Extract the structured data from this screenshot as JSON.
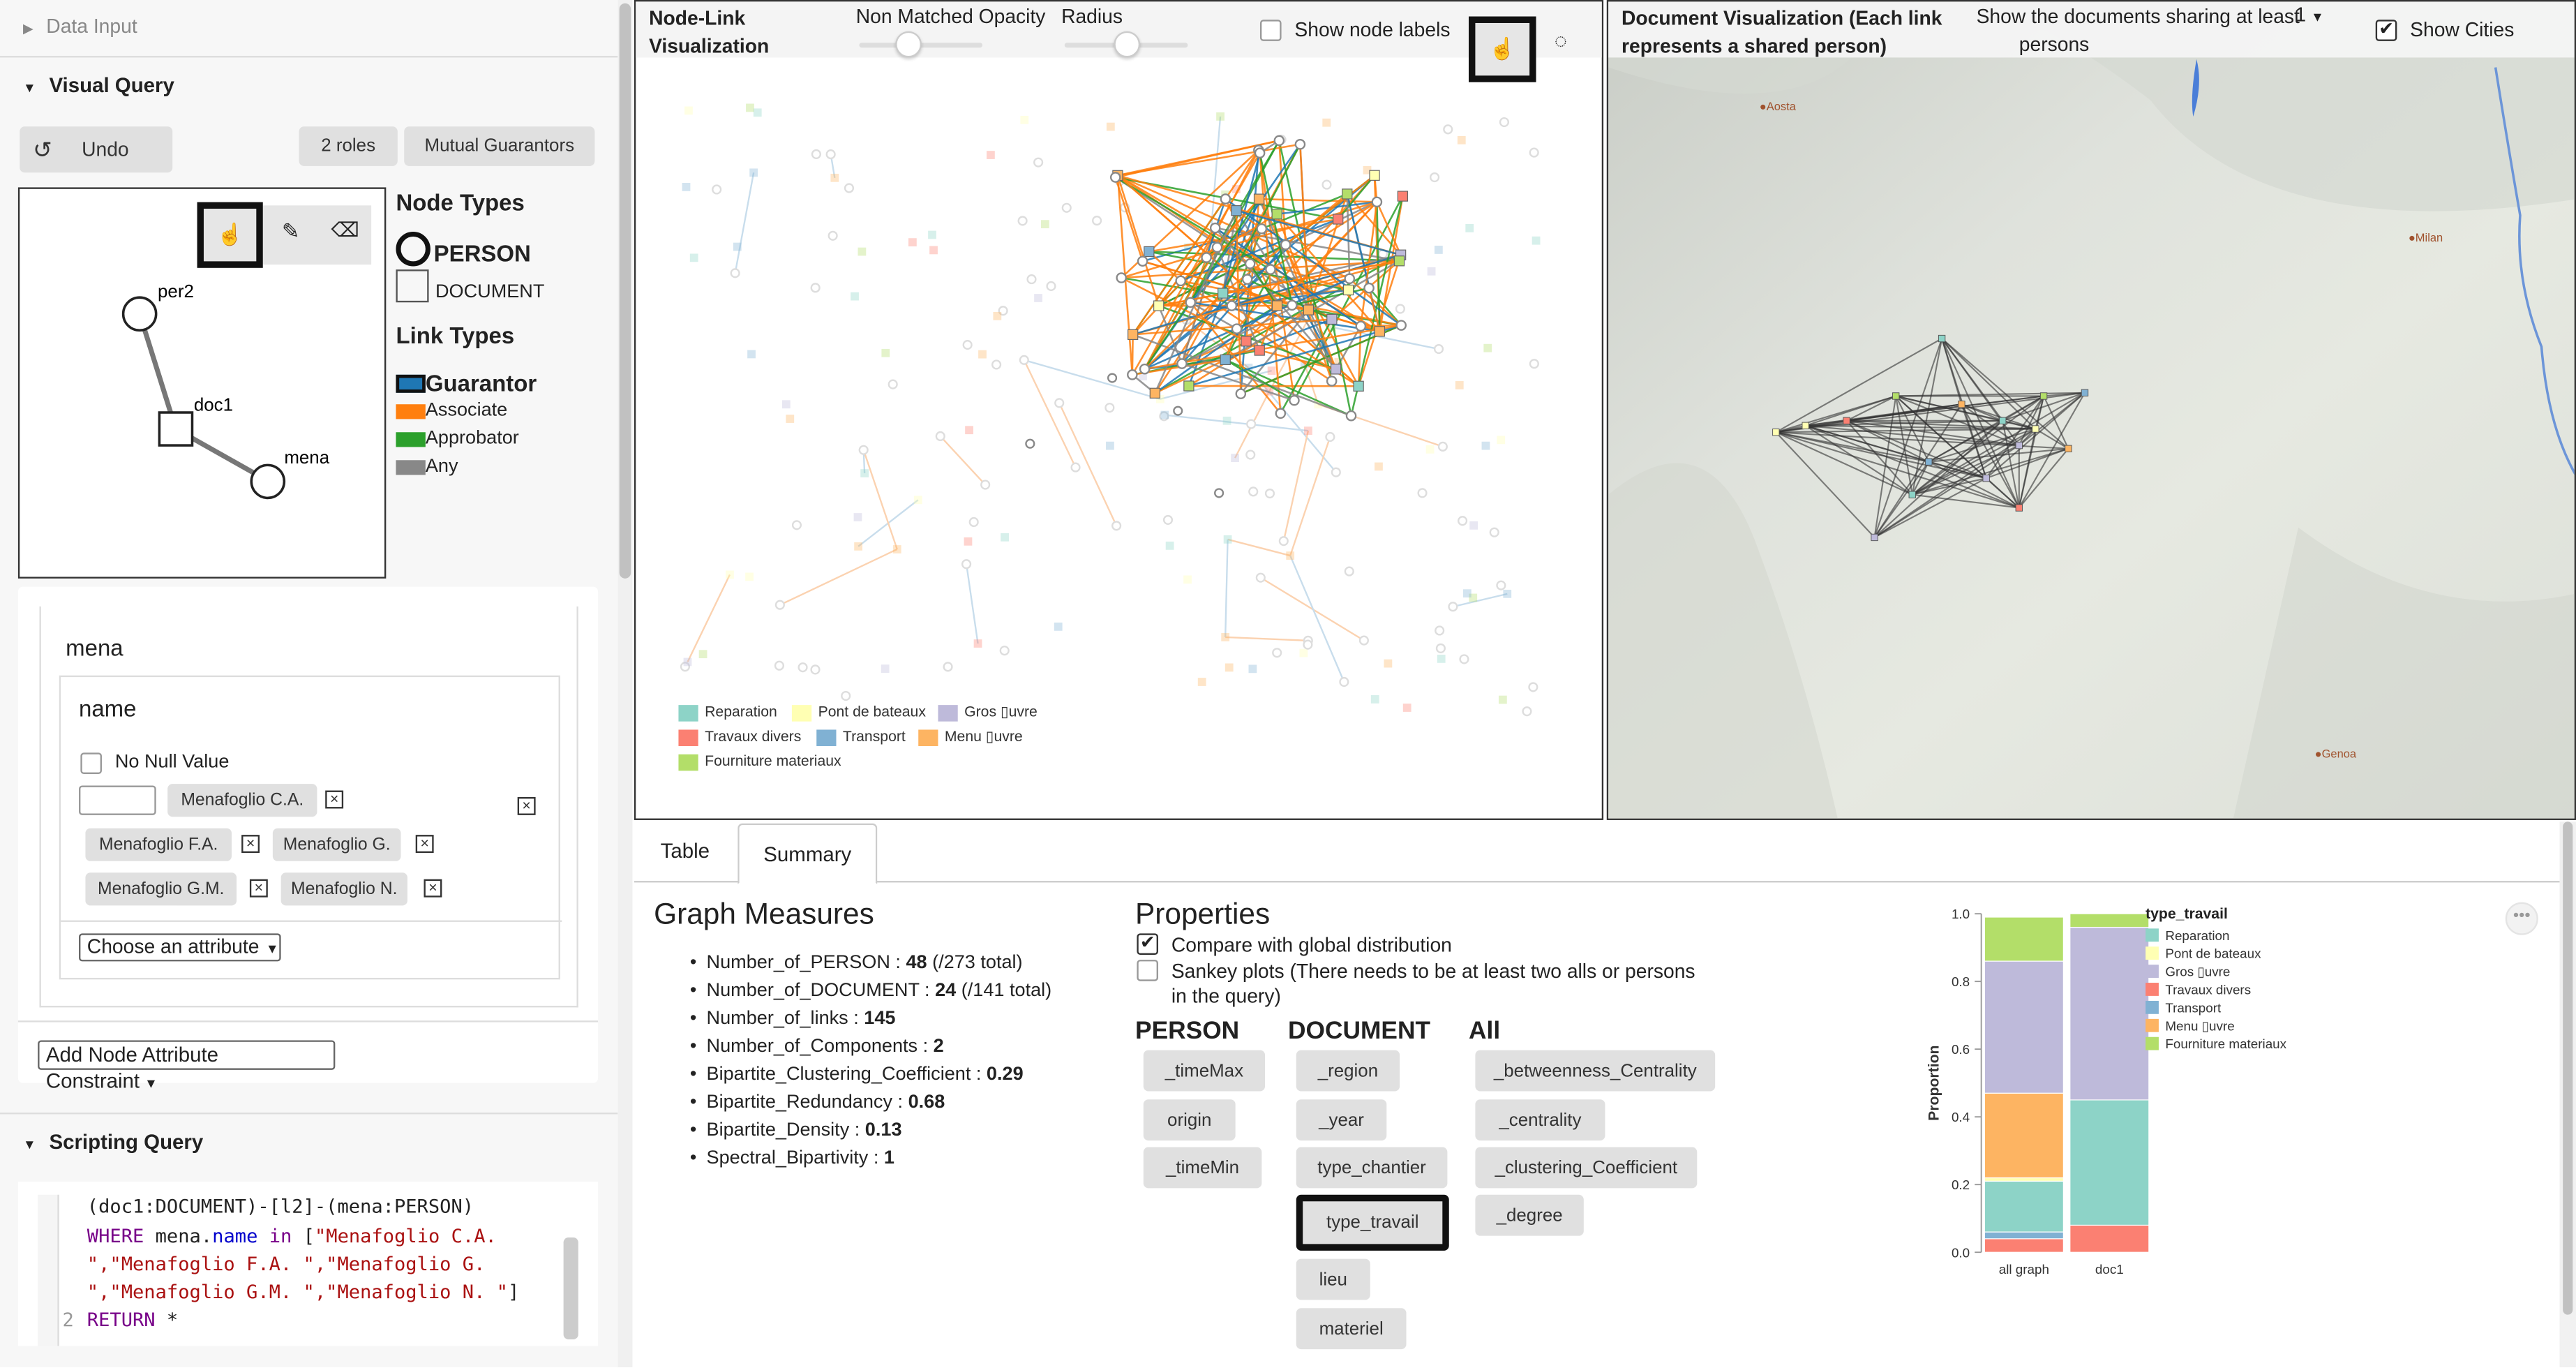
{
  "left": {
    "data_input": "Data Input",
    "visual_query": "Visual Query",
    "undo": "Undo",
    "two_roles": "2 roles",
    "mutual_guarantors": "Mutual Guarantors",
    "node_types_title": "Node Types",
    "node_person": "PERSON",
    "node_document": "DOCUMENT",
    "link_types_title": "Link Types",
    "links": [
      {
        "label": "Guarantor",
        "color": "#1f77b4"
      },
      {
        "label": "Associate",
        "color": "#ff7f0e"
      },
      {
        "label": "Approbator",
        "color": "#2ca02c"
      },
      {
        "label": "Any",
        "color": "#888888"
      }
    ],
    "graph_nodes": {
      "per2": "per2",
      "doc1": "doc1",
      "mena": "mena"
    },
    "constraint": {
      "node": "mena",
      "attribute": "name",
      "no_null": "No Null Value",
      "values": [
        "Menafoglio C.A.",
        "Menafoglio F.A.",
        "Menafoglio G.",
        "Menafoglio G.M.",
        "Menafoglio N."
      ],
      "choose_attr": "Choose an attribute"
    },
    "add_constraint": "Add Node Attribute Constraint",
    "scripting_query": "Scripting Query",
    "code": {
      "l1": "(doc1:DOCUMENT)-[l2]-(mena:PERSON)",
      "l2a": "WHERE ",
      "l2b": "mena",
      "l2c": ".",
      "l2d": "name",
      "l2e": " in ",
      "l2f": "[",
      "l2g": "\"Menafoglio C.A.",
      "l3": "\",\"Menafoglio F.A. \",\"Menafoglio G.",
      "l4": "\",\"Menafoglio G.M. \",\"Menafoglio N. \"",
      "l4b": "]",
      "ln": "2",
      "l5": "RETURN",
      "l5b": " *"
    }
  },
  "nodelink": {
    "title": "Node-Link Visualization",
    "opacity_label": "Non Matched Opacity",
    "opacity_value": 0.4,
    "radius_label": "Radius",
    "radius_value": 0.5,
    "show_labels": "Show node labels",
    "legend": [
      {
        "label": "Reparation",
        "color": "#8dd3c7"
      },
      {
        "label": "Pont de bateaux",
        "color": "#ffffb3"
      },
      {
        "label": "Gros ▯uvre",
        "color": "#bebada"
      },
      {
        "label": "Travaux divers",
        "color": "#fb8072"
      },
      {
        "label": "Transport",
        "color": "#80b1d3"
      },
      {
        "label": "Menu ▯uvre",
        "color": "#fdb462"
      },
      {
        "label": "Fourniture materiaux",
        "color": "#b3de69"
      }
    ]
  },
  "docvis": {
    "title": "Document Visualization (Each link represents a shared person)",
    "sharing_label": "Show the documents sharing at least",
    "sharing_value": "1",
    "sharing_suffix": "persons",
    "show_cities": "Show Cities",
    "cities": [
      "Aosta",
      "Milan",
      "Genoa"
    ]
  },
  "tabs": {
    "table": "Table",
    "summary": "Summary"
  },
  "measures": {
    "title": "Graph Measures",
    "items": [
      {
        "k": "Number_of_PERSON : ",
        "v": "48",
        "s": " (/273 total)"
      },
      {
        "k": "Number_of_DOCUMENT : ",
        "v": "24",
        "s": " (/141 total)"
      },
      {
        "k": "Number_of_links : ",
        "v": "145",
        "s": ""
      },
      {
        "k": "Number_of_Components : ",
        "v": "2",
        "s": ""
      },
      {
        "k": "Bipartite_Clustering_Coefficient : ",
        "v": "0.29",
        "s": ""
      },
      {
        "k": "Bipartite_Redundancy : ",
        "v": "0.68",
        "s": ""
      },
      {
        "k": "Bipartite_Density : ",
        "v": "0.13",
        "s": ""
      },
      {
        "k": "Spectral_Bipartivity : ",
        "v": "1",
        "s": ""
      }
    ]
  },
  "properties": {
    "title": "Properties",
    "compare": "Compare with global distribution",
    "sankey": "Sankey plots (There needs to be at least two alls or persons in the query)",
    "person_title": "PERSON",
    "document_title": "DOCUMENT",
    "all_title": "All",
    "person": [
      "_timeMax",
      "origin",
      "_timeMin"
    ],
    "document": [
      "_region",
      "_year",
      "type_chantier",
      "type_travail",
      "lieu",
      "materiel"
    ],
    "all": [
      "_betweenness_Centrality",
      "_centrality",
      "_clustering_Coefficient",
      "_degree"
    ]
  },
  "chart_data": {
    "type": "bar",
    "stacked": true,
    "title": "type_travail",
    "xlabel": "",
    "ylabel": "Proportion",
    "ylim": [
      0,
      1
    ],
    "yticks": [
      "0.0",
      "0.2",
      "0.4",
      "0.6",
      "0.8",
      "1.0"
    ],
    "categories": [
      "all graph",
      "doc1"
    ],
    "legend_position": "right",
    "series": [
      {
        "name": "Travaux divers",
        "color": "#fb8072",
        "values": [
          0.04,
          0.08
        ]
      },
      {
        "name": "Transport",
        "color": "#80b1d3",
        "values": [
          0.02,
          0.0
        ]
      },
      {
        "name": "Reparation",
        "color": "#8dd3c7",
        "values": [
          0.15,
          0.37
        ]
      },
      {
        "name": "Pont de bateaux",
        "color": "#ffffb3",
        "values": [
          0.01,
          0.0
        ]
      },
      {
        "name": "Menu ▯uvre",
        "color": "#fdb462",
        "values": [
          0.25,
          0.0
        ]
      },
      {
        "name": "Gros ▯uvre",
        "color": "#bebada",
        "values": [
          0.39,
          0.51
        ]
      },
      {
        "name": "Fourniture materiaux",
        "color": "#b3de69",
        "values": [
          0.13,
          0.04
        ]
      }
    ],
    "legend_order": [
      "Reparation",
      "Pont de bateaux",
      "Gros ▯uvre",
      "Travaux divers",
      "Transport",
      "Menu ▯uvre",
      "Fourniture materiaux"
    ]
  }
}
